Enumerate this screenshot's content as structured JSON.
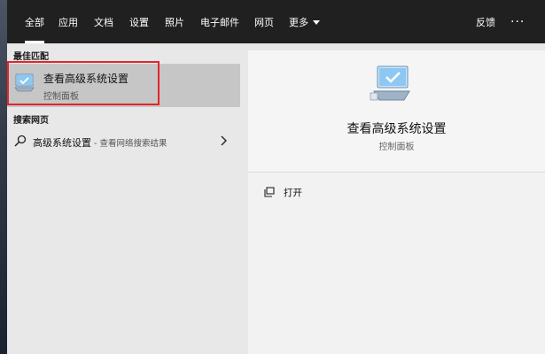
{
  "topbar": {
    "tabs": [
      {
        "label": "全部",
        "active": true
      },
      {
        "label": "应用"
      },
      {
        "label": "文档"
      },
      {
        "label": "设置"
      },
      {
        "label": "照片"
      },
      {
        "label": "电子邮件"
      },
      {
        "label": "网页"
      },
      {
        "label": "更多"
      }
    ],
    "feedback_label": "反馈",
    "more_options_icon": "ellipsis-icon"
  },
  "results": {
    "best_match_header": "最佳匹配",
    "best_match": {
      "title": "查看高级系统设置",
      "subtitle": "控制面板",
      "icon": "monitor-check-icon"
    },
    "web_header": "搜索网页",
    "web_item": {
      "query": "高级系统设置",
      "suffix": " - 查看网络搜索结果",
      "icon": "search-icon"
    }
  },
  "preview": {
    "title": "查看高级系统设置",
    "subtitle": "控制面板",
    "actions": [
      {
        "label": "打开",
        "icon": "open-window-icon"
      }
    ]
  },
  "colors": {
    "topbar_bg": "#202020",
    "selection_bg": "#c6c6c6",
    "highlight_border": "#e3262b",
    "accent_blue": "#1a8fe0"
  }
}
